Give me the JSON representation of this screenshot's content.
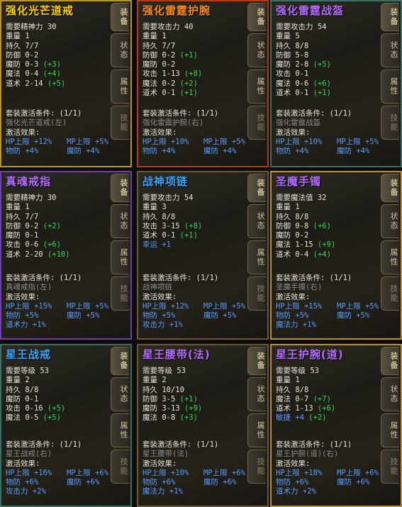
{
  "tabs": [
    "装备",
    "状态",
    "属性",
    "技能"
  ],
  "panels": [
    {
      "title": "强化光芒道戒",
      "stats": [
        {
          "text": "需要精神力 30"
        },
        {
          "text": "重量 1"
        },
        {
          "text": "持久 7/7"
        },
        {
          "text": "防御 0-2"
        },
        {
          "text": "魔防 0-3",
          "bonus": "(+3)"
        },
        {
          "text": "魔法 0-4",
          "bonus": "(+4)"
        },
        {
          "text": "道术 2-14",
          "bonus": "(+5)"
        }
      ],
      "set_title": "套装激活条件: (1/1)",
      "set_item": "强化光芒道戒(左)",
      "effect_label": "激活效果:",
      "effects": [
        [
          "HP上限 +12%",
          "MP上限 +5%"
        ],
        [
          "物防 +4%",
          "魔防 +4%"
        ]
      ]
    },
    {
      "title": "强化雷霆护腕",
      "stats": [
        {
          "text": "需要攻击力 40"
        },
        {
          "text": "重量 1"
        },
        {
          "text": "持久 7/7"
        },
        {
          "text": "防御 0-2",
          "bonus": "(+1)"
        },
        {
          "text": "魔防 0-2"
        },
        {
          "text": "攻击 1-13",
          "bonus": "(+8)"
        },
        {
          "text": "魔法 0-2",
          "bonus": "(+2)"
        },
        {
          "text": "道术 0-1",
          "bonus": "(+1)"
        }
      ],
      "set_title": "套装激活条件: (1/1)",
      "set_item": "强化雷霆护腕(右)",
      "effect_label": "激活效果:",
      "effects": [
        [
          "HP上限 +10%",
          "MP上限 +5%"
        ],
        [
          "物防 +4%",
          "魔防 +4%"
        ]
      ]
    },
    {
      "title": "强化雷霆战盔",
      "stats": [
        {
          "text": "需要攻击力 54"
        },
        {
          "text": "重量 5"
        },
        {
          "text": "持久 8/8"
        },
        {
          "text": "防御 5-8"
        },
        {
          "text": "魔防 2-8",
          "bonus": "(+5)"
        },
        {
          "text": "攻击 0-1"
        },
        {
          "text": "魔法 0-6",
          "bonus": "(+6)"
        },
        {
          "text": "道术 0-1",
          "bonus": "(+1)"
        }
      ],
      "set_title": "套装激活条件: (1/1)",
      "set_item": "强化雷霆战盔",
      "effect_label": "激活效果:",
      "effects": [
        [
          "HP上限 +10%",
          "MP上限 +5%"
        ],
        [
          "物防 +4%",
          "魔防 +4%"
        ]
      ]
    },
    {
      "title": "真魂戒指",
      "stats": [
        {
          "text": "需要精神力 30"
        },
        {
          "text": "重量 1"
        },
        {
          "text": "持久 7/7"
        },
        {
          "text": "防御 0-2",
          "bonus": "(+2)"
        },
        {
          "text": "魔防 0-1"
        },
        {
          "text": "攻击 0-6",
          "bonus": "(+6)"
        },
        {
          "text": "道术 2-20",
          "bonus": "(+10)"
        }
      ],
      "set_title": "套装激活条件: (1/1)",
      "set_item": "真魂戒指(左)",
      "effect_label": "激活效果:",
      "effects": [
        [
          "HP上限 +15%",
          "MP上限 +5%"
        ],
        [
          "物防 +5%",
          "魔防 +5%"
        ],
        [
          "道术力 +1%",
          ""
        ]
      ]
    },
    {
      "title": "战神项链",
      "stats": [
        {
          "text": "需要攻击力 54"
        },
        {
          "text": "重量 3"
        },
        {
          "text": "持久 8/8"
        },
        {
          "text": "攻击 3-15",
          "bonus": "(+8)"
        },
        {
          "text": "道术 0-1",
          "bonus": "(+1)"
        },
        {
          "text": "幸运 +1",
          "blue": true
        }
      ],
      "set_title": "套装激活条件: (1/1)",
      "set_item": "战神项链",
      "effect_label": "激活效果:",
      "effects": [
        [
          "HP上限 +12%",
          "MP上限 +5%"
        ],
        [
          "物防 +5%",
          "魔防 +5%"
        ],
        [
          "攻击力 +1%",
          ""
        ]
      ]
    },
    {
      "title": "圣魔手镯",
      "stats": [
        {
          "text": "需要魔法值 32"
        },
        {
          "text": "重量 1"
        },
        {
          "text": "持久 8/8"
        },
        {
          "text": "防御 0-8",
          "bonus": "(+6)"
        },
        {
          "text": "魔防 0-2"
        },
        {
          "text": "魔法 1-15",
          "bonus": "(+9)"
        },
        {
          "text": "道术 0-4",
          "bonus": "(+4)"
        }
      ],
      "set_title": "套装激活条件: (1/1)",
      "set_item": "圣魔手镯(右)",
      "effect_label": "激活效果:",
      "effects": [
        [
          "HP上限 +15%",
          "MP上限 +5%"
        ],
        [
          "物防 +5%",
          "魔防 +5%"
        ],
        [
          "魔法力 +1%",
          ""
        ]
      ]
    },
    {
      "title": "星王战戒",
      "stats": [
        {
          "text": "需要等级 53"
        },
        {
          "text": "重量 2"
        },
        {
          "text": "持久 8/8"
        },
        {
          "text": "魔防 0-1"
        },
        {
          "text": "攻击 0-16",
          "bonus": "(+5)"
        },
        {
          "text": "魔法 0-5",
          "bonus": "(+5)"
        }
      ],
      "set_title": "套装激活条件: (1/1)",
      "set_item": "星王战戒(右)",
      "effect_label": "激活效果:",
      "effects": [
        [
          "HP上限 +16%",
          "MP上限 +6%"
        ],
        [
          "物防 +6%",
          "魔防 +6%"
        ],
        [
          "攻击力 +2%",
          ""
        ]
      ]
    },
    {
      "title": "星王腰带(法)",
      "stats": [
        {
          "text": "需要等级 53"
        },
        {
          "text": "重量 2"
        },
        {
          "text": "持久 10/10"
        },
        {
          "text": "防御 3-5",
          "bonus": "(+1)"
        },
        {
          "text": "魔防 3-13",
          "bonus": "(+9)"
        },
        {
          "text": "魔法 0-8",
          "bonus": "(+3)"
        }
      ],
      "set_title": "套装激活条件: (1/1)",
      "set_item": "星王腰带(法)",
      "effect_label": "激活效果:",
      "effects": [
        [
          "HP上限 +10%",
          "MP上限 +6%"
        ],
        [
          "物防 +6%",
          "魔防 +6%"
        ],
        [
          "魔法力 +1%",
          ""
        ]
      ]
    },
    {
      "title": "星王护腕(道)",
      "stats": [
        {
          "text": "需要等级 53"
        },
        {
          "text": "重量 1"
        },
        {
          "text": "持久 8/8"
        },
        {
          "text": "魔法 0-7",
          "bonus": "(+7)"
        },
        {
          "text": "道术 1-13",
          "bonus": "(+6)"
        },
        {
          "text": "敏捷 +4",
          "bonus": "(+2)",
          "blue": true
        }
      ],
      "set_title": "套装激活条件: (1/1)",
      "set_item": "星王护腕(道)(右)",
      "effect_label": "激活效果:",
      "effects": [
        [
          "HP上限 +18%",
          "MP上限 +6%"
        ],
        [
          "物防 +6%",
          "魔防 +6%"
        ],
        [
          "道术力 +2%",
          ""
        ]
      ]
    }
  ],
  "colors": {
    "title_gold": "#ffd100",
    "title_purple": "#b56cff",
    "title_blue": "#37a6ff",
    "bonus_green": "#33d64f",
    "effect_blue": "#5a9cff",
    "set_gray": "#8c8c8c"
  }
}
